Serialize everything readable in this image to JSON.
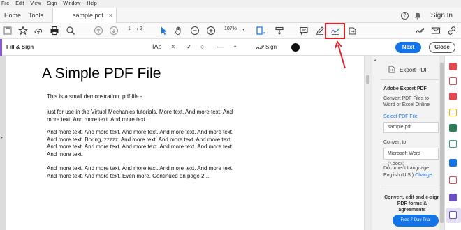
{
  "menu": [
    "File",
    "Edit",
    "View",
    "Sign",
    "Window",
    "Help"
  ],
  "tabs": {
    "home": "Home",
    "tools": "Tools",
    "document": "sample.pdf",
    "close_glyph": "×"
  },
  "header": {
    "help_glyph": "?",
    "sign_in": "Sign In"
  },
  "toolbar": {
    "current_page": "1",
    "page_total": "/ 2",
    "zoom": "107%",
    "zoom_caret": "▾",
    "icons": [
      "save-icon",
      "star-icon",
      "cloud-upload-icon",
      "print-icon",
      "zoom-search-icon",
      "page-up-icon",
      "page-down-icon",
      "select-arrow-icon",
      "hand-icon",
      "zoom-out-icon",
      "zoom-in-icon",
      "fit-page-icon",
      "scroll-mode-icon",
      "comment-icon",
      "highlight-pen-icon",
      "fill-sign-icon",
      "export-share-icon",
      "edit-sign-icon",
      "email-icon",
      "link-icon"
    ]
  },
  "fill_sign": {
    "title": "Fill & Sign",
    "tools": [
      "IAb",
      "×",
      "✓",
      "○",
      "—",
      "•"
    ],
    "sign_label": "Sign",
    "next": "Next",
    "close": "Close"
  },
  "document": {
    "title": "A Simple PDF File",
    "paragraphs": [
      "This is a small demonstration .pdf file -",
      "just for use in the Virtual Mechanics tutorials. More text. And more text. And more text. And more text. And more text.",
      "And more text. And more text. And more text. And more text. And more text. And more text. Boring, zzzzz. And more text. And more text. And more text. And more text. And more text. And more text. And more text. And more text. And more text.",
      "And more text. And more text. And more text. And more text. And more text. And more text. And more text. Even more. Continued on page 2 ..."
    ]
  },
  "panel": {
    "export_label": "Export PDF",
    "heading": "Adobe Export PDF",
    "description": "Convert PDF Files to Word or Excel Online",
    "select_link": "Select PDF File",
    "file_name": "sample.pdf",
    "convert_label": "Convert to",
    "convert_value": "Microsoft Word (*.docx)",
    "language_label": "Document Language:",
    "language_value": "English (U.S.)",
    "change_link": "Change",
    "promo": "Convert, edit and e-sign PDF forms & agreements",
    "trial_button": "Free 7-Day Trial",
    "collapse_glyph": "◂"
  },
  "rail_icons": [
    {
      "name": "export-pdf-rail-icon",
      "color": "#e34850"
    },
    {
      "name": "create-pdf-rail-icon",
      "color": "#e34850"
    },
    {
      "name": "edit-pdf-rail-icon",
      "color": "#e34850"
    },
    {
      "name": "comment-rail-icon",
      "color": "#f5b300"
    },
    {
      "name": "combine-rail-icon",
      "color": "#2d7d5b"
    },
    {
      "name": "organize-rail-icon",
      "color": "#2d9d78"
    },
    {
      "name": "scan-rail-icon",
      "color": "#1473e6"
    },
    {
      "name": "compress-rail-icon",
      "color": "#e34850"
    },
    {
      "name": "protect-rail-icon",
      "color": "#6a4fc7"
    },
    {
      "name": "fill-sign-rail-icon",
      "color": "#6a4fc7"
    }
  ],
  "colors": {
    "accent_blue": "#1473e6",
    "fill_sign_purple": "#8a5bd6",
    "highlight_red": "#e0202a"
  }
}
